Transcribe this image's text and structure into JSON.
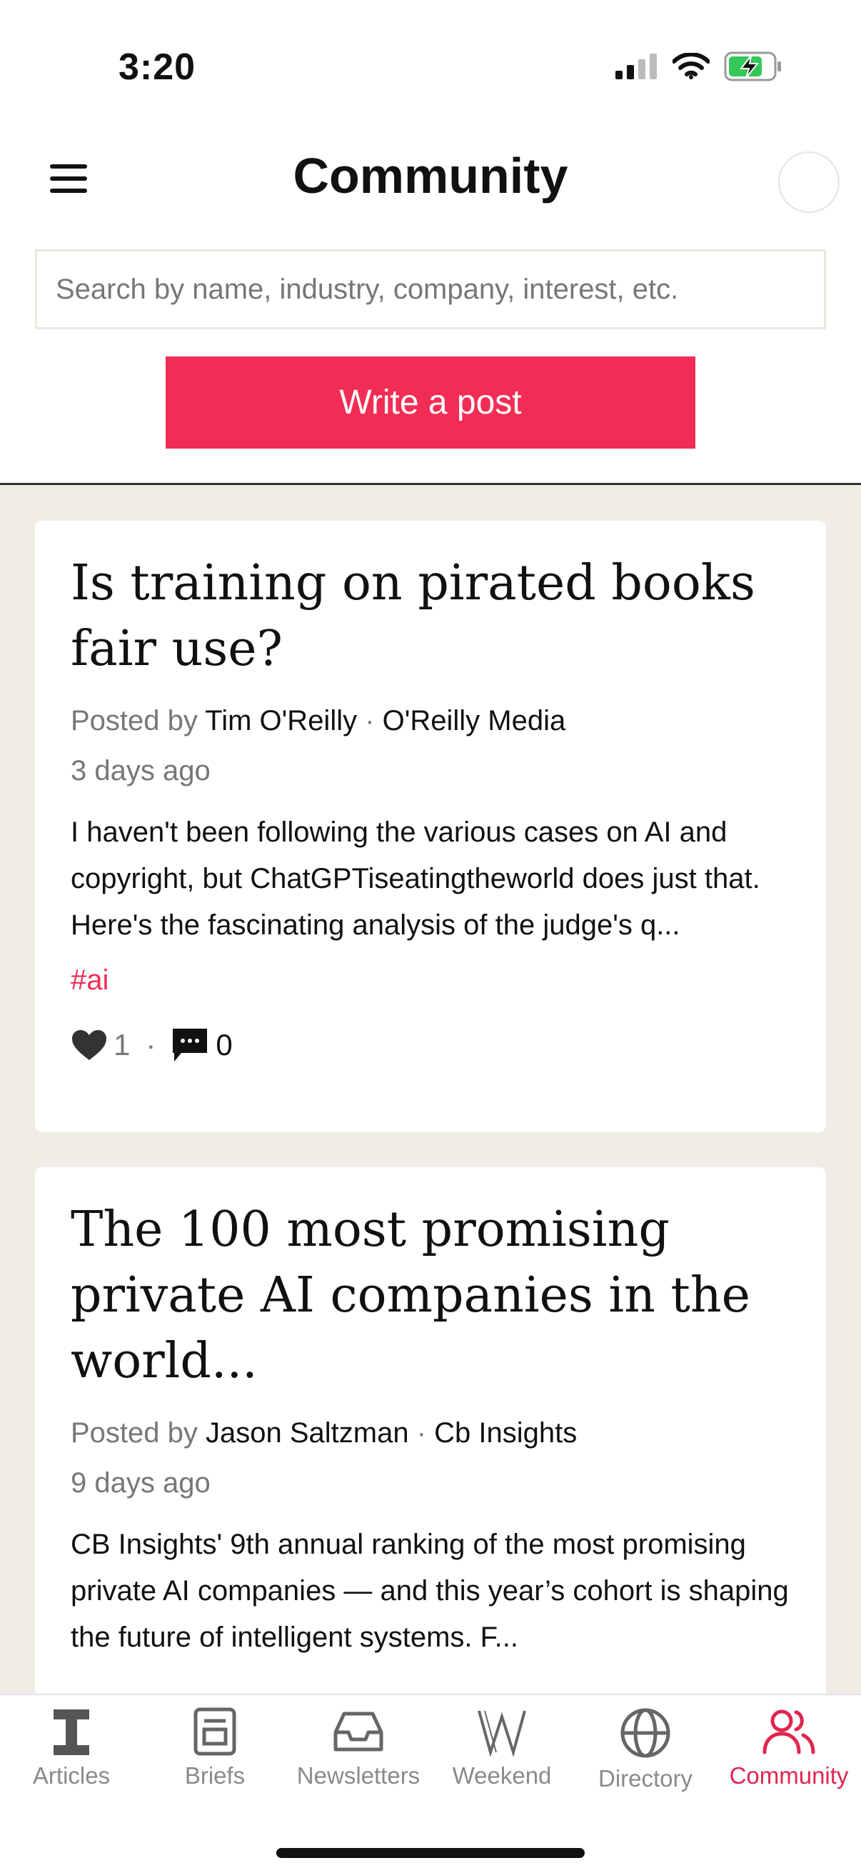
{
  "status_bar": {
    "time": "3:20"
  },
  "header": {
    "title": "Community"
  },
  "search": {
    "placeholder": "Search by name, industry, company, interest, etc."
  },
  "write_button": {
    "label": "Write a post"
  },
  "colors": {
    "accent": "#f22d55",
    "feed_bg": "#f0ece6"
  },
  "posts": [
    {
      "title": "Is training on pirated books fair use?",
      "posted_by": "Posted by",
      "author": "Tim O'Reilly",
      "separator": " · ",
      "company": "O'Reilly Media",
      "age": "3 days ago",
      "excerpt": "I haven't been following the various cases on AI and copyright, but ChatGPTiseatingtheworld does just that. Here's the fascinating analysis of the judge's q...",
      "tag": "#ai",
      "likes": "1",
      "dot": "·",
      "comments": "0"
    },
    {
      "title": "The 100 most promising private AI companies in the world...",
      "posted_by": "Posted by",
      "author": "Jason Saltzman",
      "separator": " · ",
      "company": "Cb Insights",
      "age": "9 days ago",
      "excerpt": "CB Insights' 9th annual ranking of the most promising private AI companies — and this year’s cohort is shaping the future of intelligent systems.  F..."
    }
  ],
  "tabs": [
    {
      "label": "Articles",
      "icon": "articles-icon"
    },
    {
      "label": "Briefs",
      "icon": "briefs-icon"
    },
    {
      "label": "Newsletters",
      "icon": "inbox-icon"
    },
    {
      "label": "Weekend",
      "icon": "weekend-icon"
    },
    {
      "label": "Directory",
      "icon": "globe-icon"
    },
    {
      "label": "Community",
      "icon": "people-icon",
      "active": true
    }
  ]
}
